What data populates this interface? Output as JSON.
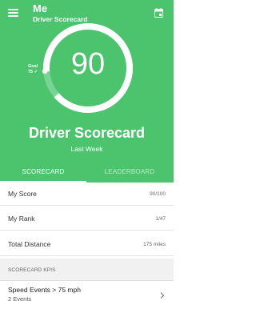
{
  "header": {
    "title": "Me",
    "subtitle": "Driver Scorecard",
    "icons": {
      "menu": "hamburger-menu-icon",
      "calendar": "calendar-icon"
    },
    "accent_color": "#4cc46e"
  },
  "gauge": {
    "score": "90",
    "goal_label": "Goal",
    "goal_value": "75 ✓",
    "progress": 0.9
  },
  "summary": {
    "heading": "Driver Scorecard",
    "period": "Last Week"
  },
  "tabs": [
    {
      "label": "SCORECARD",
      "selected": true
    },
    {
      "label": "LEADERBOARD",
      "selected": false
    }
  ],
  "rows": [
    {
      "label": "My Score",
      "value": "90/100"
    },
    {
      "label": "My Rank",
      "value": "1/47"
    },
    {
      "label": "Total Distance",
      "value": "175 miles"
    }
  ],
  "kpis": {
    "section_label": "SCORECARD KPIS",
    "items": [
      {
        "title": "Speed Events > 75 mph",
        "subtitle": "2 Events"
      }
    ]
  }
}
